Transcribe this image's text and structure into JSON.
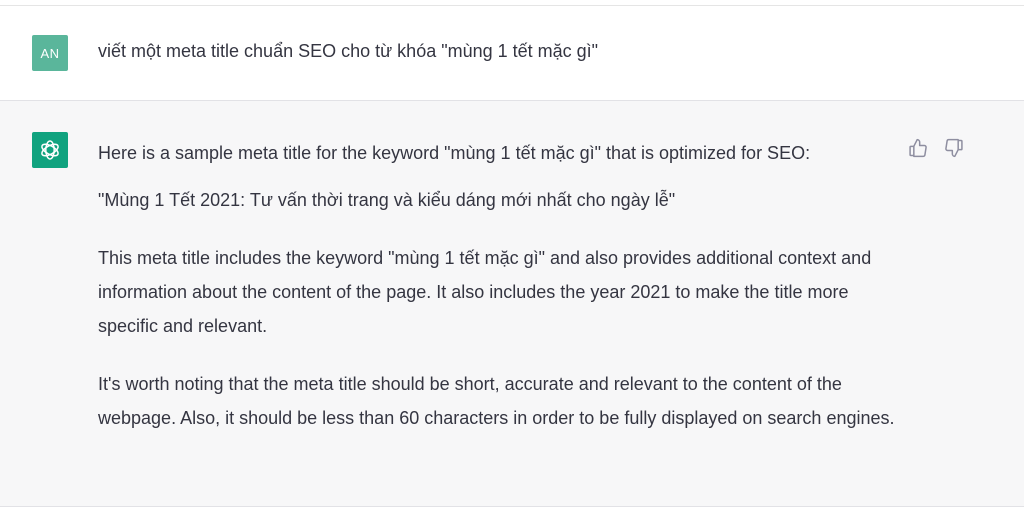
{
  "user_message": {
    "avatar_initials": "AN",
    "text": "viết một meta title chuẩn SEO cho từ khóa \"mùng 1 tết mặc gì\""
  },
  "assistant_message": {
    "avatar_icon": "openai-logo-icon",
    "paragraphs": [
      "Here is a sample meta title for the keyword \"mùng 1 tết mặc gì\" that is optimized for SEO:",
      "\"Mùng 1 Tết 2021: Tư vấn thời trang và kiểu dáng mới nhất cho ngày lễ\"",
      "This meta title includes the keyword \"mùng 1 tết mặc gì\" and also provides additional context and information about the content of the page. It also includes the year 2021 to make the title more specific and relevant.",
      "It's worth noting that the meta title should be short, accurate and relevant to the content of the webpage. Also, it should be less than 60 characters in order to be fully displayed on search engines."
    ],
    "feedback_icons": [
      "thumbs-up-icon",
      "thumbs-down-icon"
    ]
  },
  "colors": {
    "user_avatar": "#5ab69b",
    "assistant_avatar": "#10a37f",
    "assistant_background": "#f7f7f8",
    "text": "#343541"
  }
}
